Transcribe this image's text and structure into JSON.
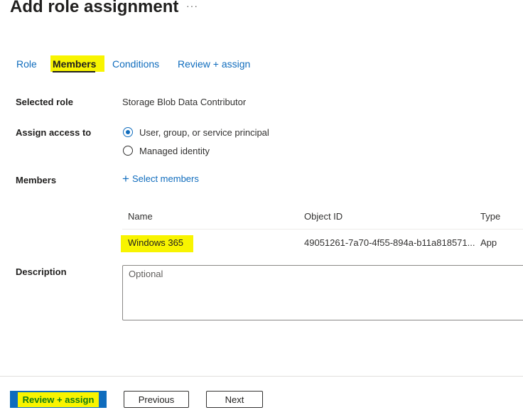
{
  "header": {
    "title": "Add role assignment",
    "more_label": "···"
  },
  "tabs": [
    {
      "label": "Role",
      "active": false
    },
    {
      "label": "Members",
      "active": true
    },
    {
      "label": "Conditions",
      "active": false
    },
    {
      "label": "Review + assign",
      "active": false
    }
  ],
  "form": {
    "selected_role": {
      "label": "Selected role",
      "value": "Storage Blob Data Contributor"
    },
    "assign_access": {
      "label": "Assign access to",
      "options": [
        {
          "label": "User, group, or service principal",
          "checked": true
        },
        {
          "label": "Managed identity",
          "checked": false
        }
      ]
    },
    "members": {
      "label": "Members",
      "select_label": "Select members",
      "columns": [
        "Name",
        "Object ID",
        "Type"
      ],
      "rows": [
        {
          "name": "Windows 365",
          "object_id": "49051261-7a70-4f55-894a-b11a818571...",
          "type": "App"
        }
      ]
    },
    "description": {
      "label": "Description",
      "placeholder": "Optional",
      "value": ""
    }
  },
  "footer": {
    "review_label": "Review + assign",
    "previous_label": "Previous",
    "next_label": "Next"
  },
  "colors": {
    "accent": "#0f6cbd",
    "highlight": "#f8f400",
    "review_text": "#107c10"
  }
}
